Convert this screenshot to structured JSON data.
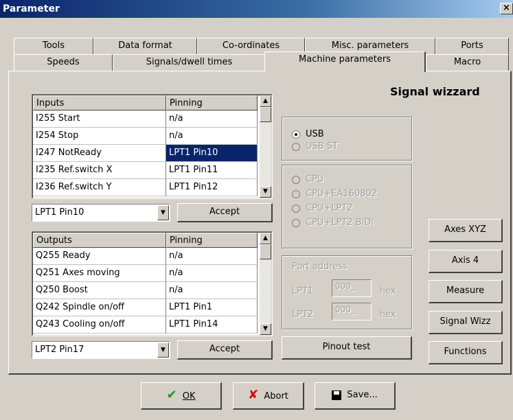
{
  "window": {
    "title": "Parameter",
    "close": "×"
  },
  "tabs_back": [
    "Tools",
    "Data format",
    "Co-ordinates",
    "Misc. parameters",
    "Ports"
  ],
  "tabs_front": [
    "Speeds",
    "Signals/dwell times",
    "Machine parameters",
    "Macro"
  ],
  "active_tab": "Machine parameters",
  "signal_wizard_title": "Signal wizzard",
  "inputs_table": {
    "columns": [
      "Inputs",
      "Pinning"
    ],
    "rows": [
      [
        "I255 Start",
        "n/a"
      ],
      [
        "I254 Stop",
        "n/a"
      ],
      [
        "I247 NotReady",
        "LPT1 Pin10"
      ],
      [
        "I235 Ref.switch X",
        "LPT1 Pin11"
      ],
      [
        "I236 Ref.switch Y",
        "LPT1 Pin12"
      ]
    ],
    "selected_row": 2
  },
  "inputs_combo": {
    "value": "LPT1 Pin10"
  },
  "inputs_accept": "Accept",
  "outputs_table": {
    "columns": [
      "Outputs",
      "Pinning"
    ],
    "rows": [
      [
        "Q255 Ready",
        "n/a"
      ],
      [
        "Q251 Axes moving",
        "n/a"
      ],
      [
        "Q250 Boost",
        "n/a"
      ],
      [
        "Q242 Spindle on/off",
        "LPT1 Pin1"
      ],
      [
        "Q243 Cooling on/off",
        "LPT1 Pin14"
      ]
    ]
  },
  "outputs_combo": {
    "value": "LPT2 Pin17"
  },
  "outputs_accept": "Accept",
  "interface_group": {
    "options": [
      "USB",
      "USB ST"
    ],
    "selected": 0
  },
  "cpu_group": {
    "options": [
      "CPU",
      "CPU+EA160802",
      "CPU+LPT2",
      "CPU+LPT2 BiDi"
    ]
  },
  "port_address": {
    "label": "Port address",
    "lpt1_label": "LPT1",
    "lpt1_value": "000_",
    "lpt2_label": "LPT2",
    "lpt2_value": "000_",
    "unit": "hex"
  },
  "pinout_test": "Pinout test",
  "side_buttons": [
    "Axes XYZ",
    "Axis 4",
    "Measure",
    "Signal Wizz",
    "Functions"
  ],
  "footer": {
    "ok": "OK",
    "abort": "Abort",
    "save": "Save..."
  }
}
